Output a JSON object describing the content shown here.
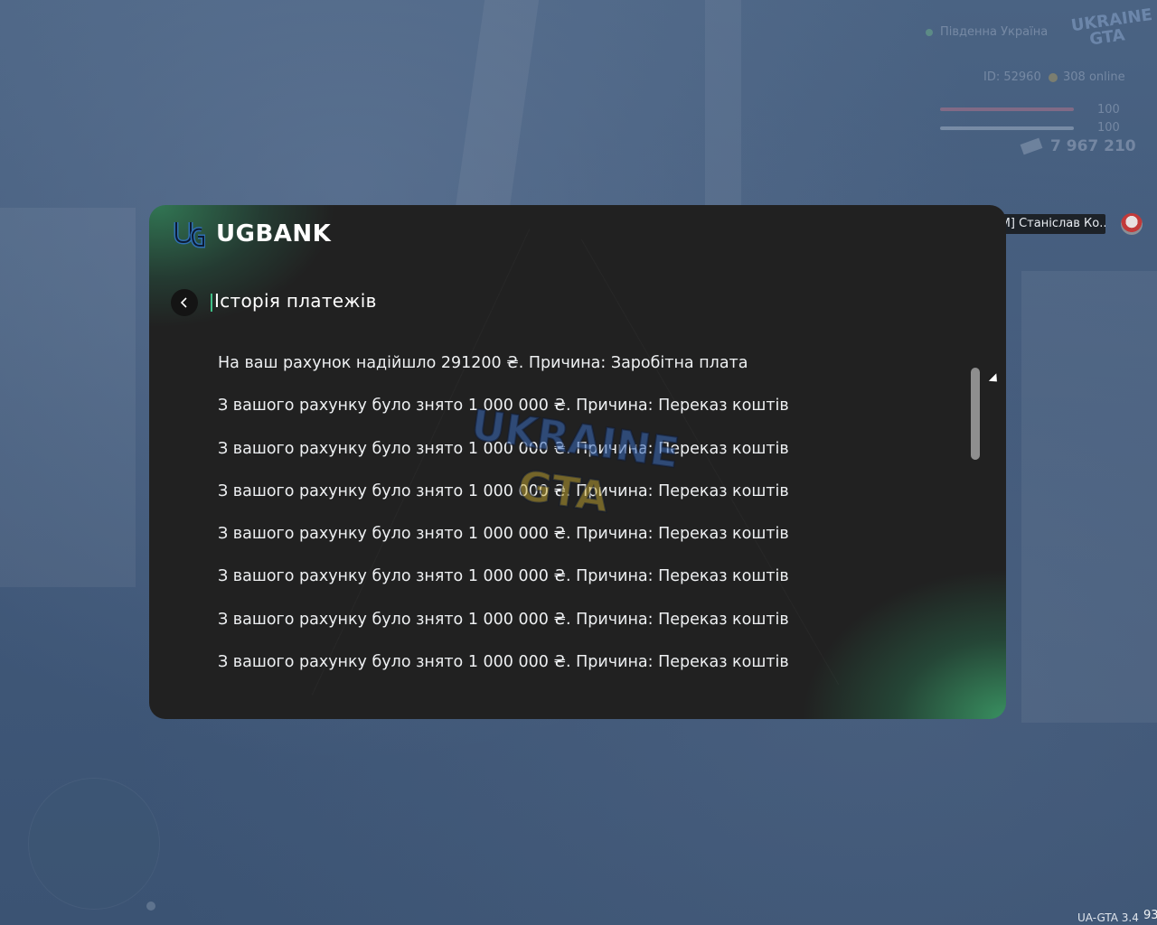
{
  "bank": {
    "logo_text": "UGBANK",
    "title": "Історія платежів",
    "transactions": [
      "На ваш рахунок надійшло 291200 ₴. Причина: Заробітна плата",
      "З вашого рахунку було знято 1 000 000 ₴. Причина: Переказ коштів",
      "З вашого рахунку було знято 1 000 000 ₴. Причина: Переказ коштів",
      "З вашого рахунку було знято 1 000 000 ₴. Причина: Переказ коштів",
      "З вашого рахунку було знято 1 000 000 ₴. Причина: Переказ коштів",
      "З вашого рахунку було знято 1 000 000 ₴. Причина: Переказ коштів",
      "З вашого рахунку було знято 1 000 000 ₴. Причина: Переказ коштів",
      "З вашого рахунку було знято 1 000 000 ₴. Причина: Переказ коштів"
    ],
    "watermark_line1": "UKRAINE",
    "watermark_line2": "GTA",
    "accent_color": "#3fbf86"
  },
  "hud": {
    "server": "Південна Україна",
    "logo_line1": "UKRAINE",
    "logo_line2": "GTA",
    "player_id": "ID: 52960",
    "online": "308 online",
    "health": "100",
    "armor": "100",
    "money": "7 967 210"
  },
  "user_tag": "[ТВО S.M] Станіслав Ко...",
  "version": "UA-GTA 3.4",
  "version_number": "93"
}
